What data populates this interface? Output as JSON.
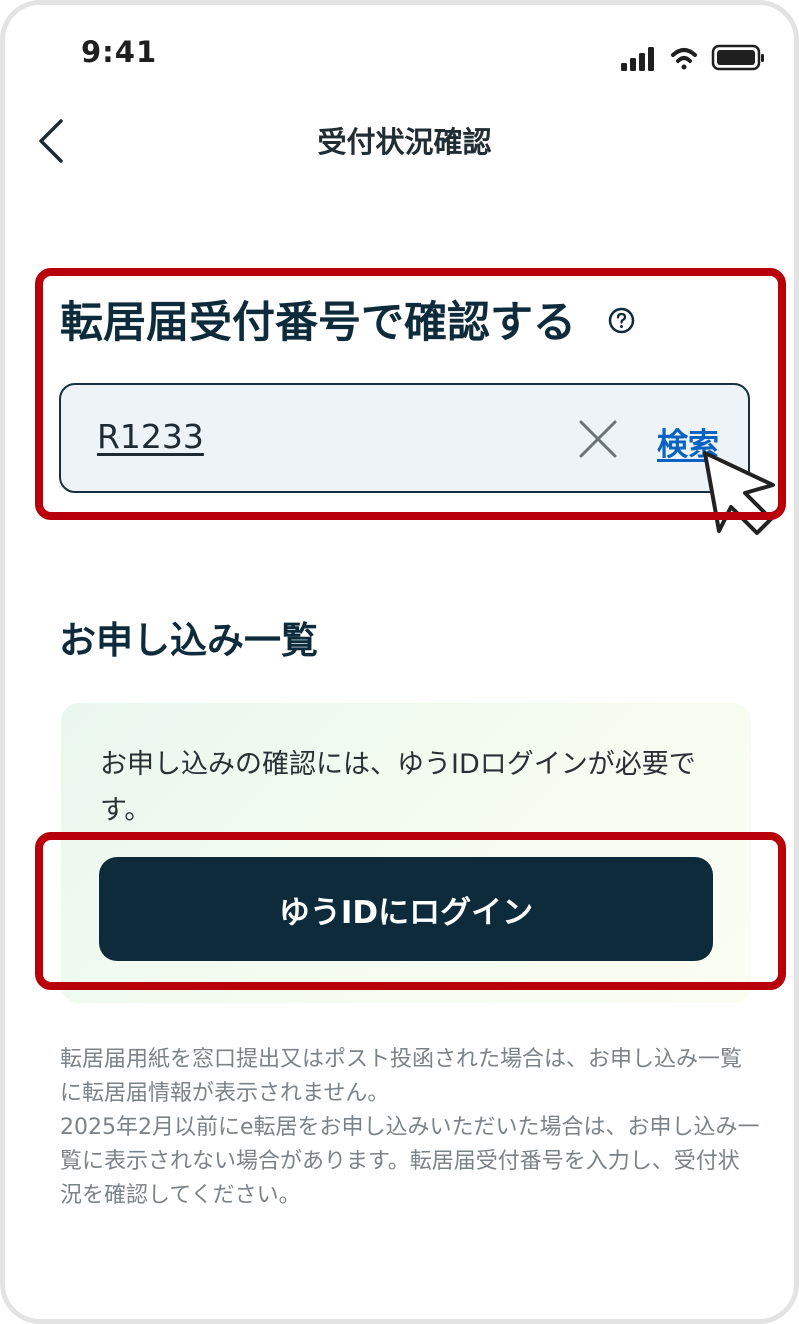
{
  "status_bar": {
    "time": "9:41",
    "icons": [
      "signal-icon",
      "wifi-icon",
      "battery-icon"
    ]
  },
  "nav": {
    "back_icon": "chevron-left-icon",
    "title": "受付状況確認"
  },
  "search_section": {
    "title": "転居届受付番号で確認する",
    "help_icon": "question-circle-icon",
    "input_value": "R1233",
    "clear_icon": "close-icon",
    "search_label": "検索"
  },
  "list_section": {
    "title": "お申し込み一覧",
    "info_text": "お申し込みの確認には、ゆうIDログインが必要です。",
    "login_button_label": "ゆうIDにログイン"
  },
  "notes": {
    "paragraph_1": "転居届用紙を窓口提出又はポスト投函された場合は、お申し込み一覧に転居届情報が表示されません。",
    "paragraph_2": "2025年2月以前にe転居をお申し込みいただいた場合は、お申し込み一覧に表示されない場合があります。転居届受付番号を入力し、受付状況を確認してください。"
  },
  "colors": {
    "primary_dark": "#0d2b3b",
    "link_blue": "#0a63c2",
    "highlight_red": "#b8000b",
    "input_bg": "#edf3f6",
    "note_gray": "#7c8388"
  }
}
